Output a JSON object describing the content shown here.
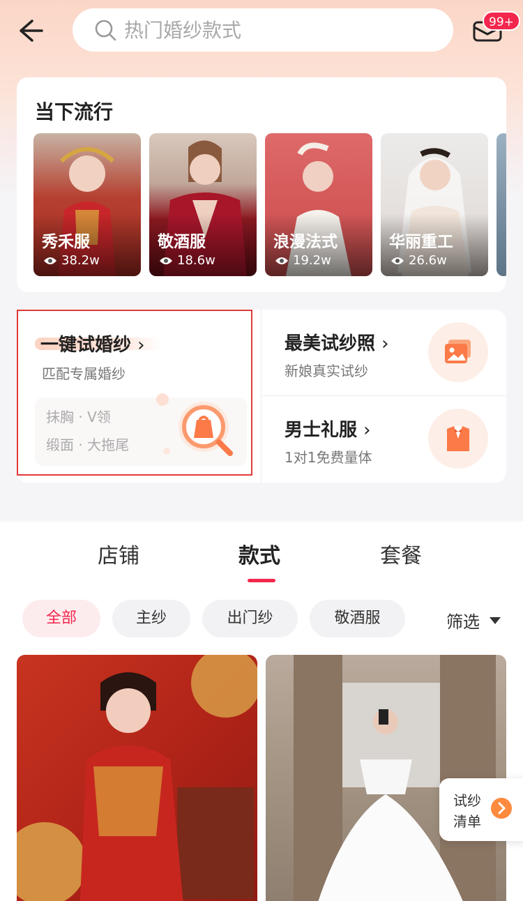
{
  "header": {
    "search_placeholder": "热门婚纱款式",
    "message_badge": "99+"
  },
  "trending": {
    "title": "当下流行",
    "items": [
      {
        "name": "秀禾服",
        "views": "38.2w"
      },
      {
        "name": "敬酒服",
        "views": "18.6w"
      },
      {
        "name": "浪漫法式",
        "views": "19.2w"
      },
      {
        "name": "华丽重工",
        "views": "26.6w"
      }
    ]
  },
  "tools": {
    "try_on": {
      "title": "一键试婚纱",
      "subtitle": "匹配专属婚纱",
      "tags_line1": "抹胸 · V领",
      "tags_line2": "缎面 · 大拖尾"
    },
    "photos": {
      "title": "最美试纱照",
      "subtitle": "新娘真实试纱"
    },
    "menswear": {
      "title": "男士礼服",
      "subtitle": "1对1免费量体"
    }
  },
  "tabs": [
    {
      "label": "店铺"
    },
    {
      "label": "款式"
    },
    {
      "label": "套餐"
    }
  ],
  "filters": {
    "chips": [
      {
        "label": "全部"
      },
      {
        "label": "主纱"
      },
      {
        "label": "出门纱"
      },
      {
        "label": "敬酒服"
      }
    ],
    "filter_label": "筛选"
  },
  "float_button": {
    "line1": "试纱",
    "line2": "清单"
  },
  "colors": {
    "accent": "#f3264d",
    "orange": "#fe8a3e"
  }
}
